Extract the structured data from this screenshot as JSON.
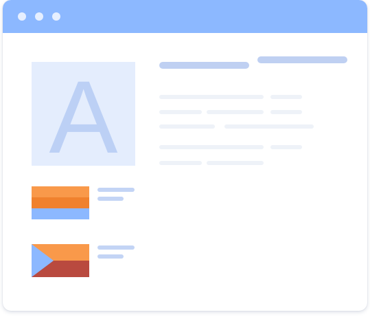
{
  "colors": {
    "titlebar": "#8cb8ff",
    "window_dot": "#e6efff",
    "tile_bg": "#e4edfd",
    "glyph": "#bcd0f5",
    "header_bar": "#bfd0f2",
    "text_bar": "#eef2f8",
    "side_bar": "#c3d4f5",
    "flag_orange": "#f9994a",
    "flag_orange_dark": "#f0812d",
    "flag_blue": "#8cb8ff",
    "flag_red": "#b94a3f"
  },
  "hero": {
    "letter": "A"
  },
  "icons": {
    "flag_striped": "striped-flag-icon",
    "flag_chevron": "chevron-flag-icon"
  }
}
